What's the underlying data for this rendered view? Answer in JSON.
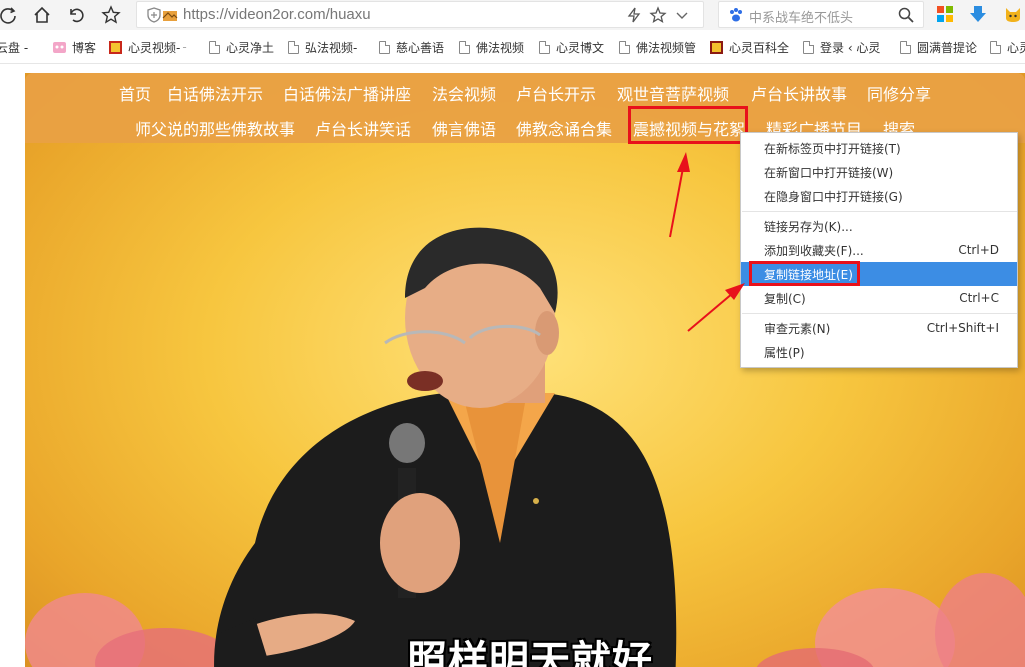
{
  "browser": {
    "url": "https://videon2or.com/huaxu",
    "search_placeholder": "中系战车绝不低头"
  },
  "bookmarks": [
    {
      "label": "云盘 -",
      "icon": "none"
    },
    {
      "label": "博客",
      "icon": "blog-favicon"
    },
    {
      "label": "心灵视频-",
      "icon": "video-favicon",
      "trail": "-"
    },
    {
      "label": "心灵净土",
      "icon": "doc"
    },
    {
      "label": "弘法视频-",
      "icon": "doc"
    },
    {
      "label": "慈心善语",
      "icon": "doc"
    },
    {
      "label": "佛法视频",
      "icon": "doc"
    },
    {
      "label": "心灵博文",
      "icon": "doc"
    },
    {
      "label": "佛法视频管",
      "icon": "doc"
    },
    {
      "label": "心灵百科全",
      "icon": "baike-favicon"
    },
    {
      "label": "登录 ‹ 心灵",
      "icon": "doc"
    },
    {
      "label": "圆满普提论",
      "icon": "doc"
    },
    {
      "label": "心灵",
      "icon": "doc"
    }
  ],
  "nav": {
    "row1": [
      "首页",
      "白话佛法开示",
      "白话佛法广播讲座",
      "法会视频",
      "卢台长开示",
      "观世音菩萨视频",
      "卢台长讲故事",
      "同修分享"
    ],
    "row2": [
      "师父说的那些佛教故事",
      "卢台长讲笑话",
      "佛言佛语",
      "佛教念诵合集",
      "震撼视频与花絮",
      "精彩广播节目",
      "搜索"
    ]
  },
  "video": {
    "subtitle": "照样明天就好"
  },
  "context_menu": {
    "items": [
      {
        "label": "在新标签页中打开链接(T)",
        "shortcut": ""
      },
      {
        "label": "在新窗口中打开链接(W)",
        "shortcut": ""
      },
      {
        "label": "在隐身窗口中打开链接(G)",
        "shortcut": ""
      },
      {
        "label": "链接另存为(K)...",
        "shortcut": ""
      },
      {
        "label": "添加到收藏夹(F)...",
        "shortcut": "Ctrl+D"
      },
      {
        "label": "复制链接地址(E)",
        "shortcut": ""
      },
      {
        "label": "复制(C)",
        "shortcut": "Ctrl+C"
      },
      {
        "label": "审查元素(N)",
        "shortcut": "Ctrl+Shift+I"
      },
      {
        "label": "属性(P)",
        "shortcut": ""
      }
    ],
    "highlighted": "复制链接地址(E)"
  },
  "colors": {
    "nav_bg": "#e9a044",
    "highlight": "#e8111b",
    "menu_active": "#3c8de4"
  }
}
